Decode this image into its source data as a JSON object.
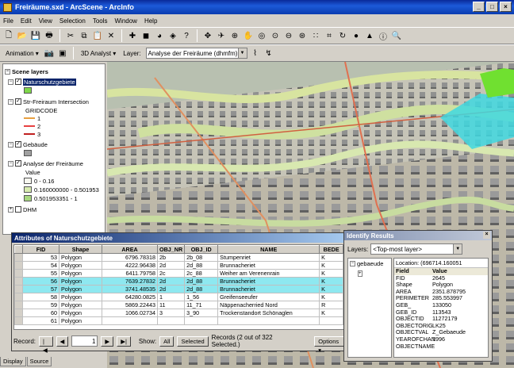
{
  "window": {
    "title": "Freiräume.sxd - ArcScene - ArcInfo"
  },
  "menu": [
    "File",
    "Edit",
    "View",
    "Selection",
    "Tools",
    "Window",
    "Help"
  ],
  "toolbar2": {
    "animation_label": "Animation ▾",
    "analyst_label": "3D Analyst ▾",
    "layer_label": "Layer:",
    "layer_value": "Analyse der Freiräume (dhmfm)"
  },
  "toc": {
    "root": "Scene layers",
    "layers": [
      "Naturschutzgebiete",
      "Str-Freiraum Intersection",
      "GRIDCODE",
      "1",
      "2",
      "3",
      "Gebäude",
      "Analyse der Freiräume",
      "Value",
      "0 - 0.16",
      "0.160000000 - 0.501953",
      "0.501953351 - 1",
      "DHM"
    ]
  },
  "attr": {
    "title": "Attributes of Naturschutzgebiete",
    "columns": [
      "FID",
      "Shape",
      "AREA",
      "OBJ_NR",
      "OBJ_ID",
      "NAME",
      "BEDE"
    ],
    "rows": [
      [
        "53",
        "Polygon",
        "6796.78318",
        "2b",
        "2b_08",
        "Stumpenriet",
        "K"
      ],
      [
        "54",
        "Polygon",
        "4222.96438",
        "2d",
        "2d_88",
        "Brunnacheriet",
        "K"
      ],
      [
        "55",
        "Polygon",
        "6411.79758",
        "2c",
        "2c_88",
        "Weiher am Verenenrain",
        "K"
      ],
      [
        "56",
        "Polygon",
        "7639.27832",
        "2d",
        "2d_88",
        "Brunnacheriet",
        "K"
      ],
      [
        "57",
        "Polygon",
        "3741.48535",
        "2d",
        "2d_88",
        "Brunnacheriet",
        "K"
      ],
      [
        "58",
        "Polygon",
        "64280.0825",
        "1",
        "1_56",
        "Greifenseeufer",
        "K"
      ],
      [
        "59",
        "Polygon",
        "5869.22443",
        "11",
        "11_71",
        "Näppenacherried Nord",
        "R"
      ],
      [
        "60",
        "Polygon",
        "1066.02734",
        "3",
        "3_90",
        "Trockenstandort Schönaglen",
        "K"
      ],
      [
        "61",
        "Polygon",
        "",
        "",
        "",
        "",
        ""
      ]
    ],
    "record_label": "Record:",
    "record_value": "1",
    "show_label": "Show:",
    "all_label": "All",
    "selected_label": "Selected",
    "records_text": "Records (2 out of 322 Selected.)",
    "options_label": "Options ▾"
  },
  "identify": {
    "title": "Identify Results",
    "layers_label": "Layers:",
    "layers_value": "<Top-most layer>",
    "tree_item": "gebaeude",
    "location_label": "Location:",
    "location_value": "(696714.160051",
    "field_header": "Field",
    "value_header": "Value",
    "fields": [
      [
        "FID",
        "2645"
      ],
      [
        "Shape",
        "Polygon"
      ],
      [
        "AREA",
        "2351.878795"
      ],
      [
        "PERIMETER",
        "285.553997"
      ],
      [
        "GEB_",
        "133050"
      ],
      [
        "GEB_ID",
        "113543"
      ],
      [
        "OBJECTID",
        "11272179"
      ],
      [
        "OBJECTORIG",
        "LK25"
      ],
      [
        "OBJECTVAL",
        "Z_Gebaeude"
      ],
      [
        "YEAROFCHAN",
        "1996"
      ],
      [
        "OBJECTNAME",
        ""
      ]
    ]
  },
  "tabs": [
    "Display",
    "Source"
  ]
}
